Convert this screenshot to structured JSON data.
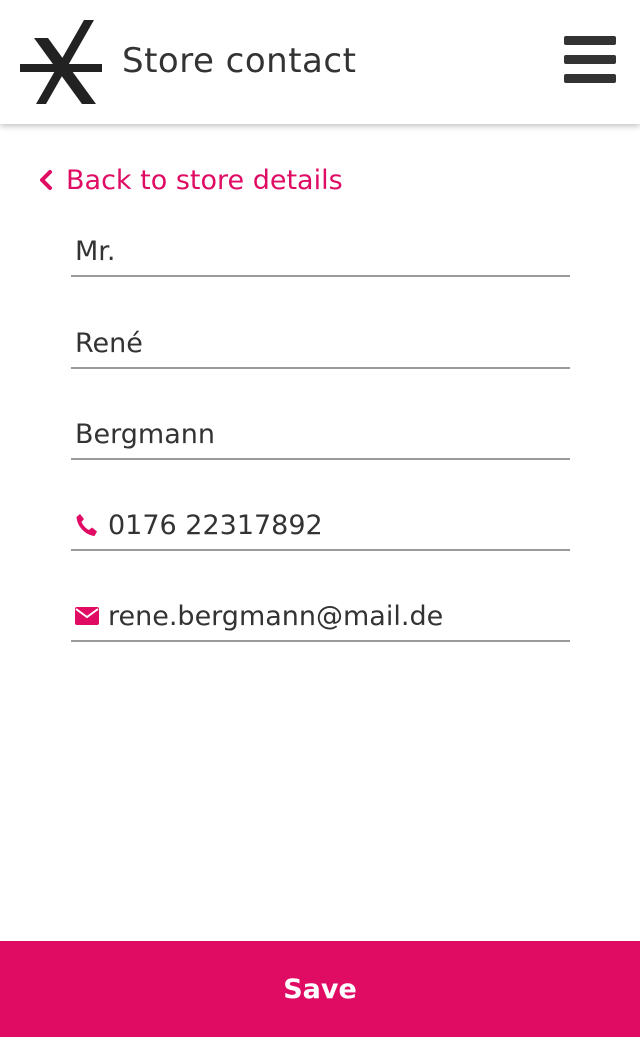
{
  "header": {
    "title": "Store contact",
    "logo_icon": "asterisk-x-logo",
    "menu_icon": "hamburger-menu-icon"
  },
  "back_link": {
    "icon": "chevron-left-icon",
    "label": "Back to store details"
  },
  "form": {
    "salutation": "Mr.",
    "first_name": "René",
    "last_name": "Bergmann",
    "phone": {
      "icon": "phone-icon",
      "value": "0176 22317892"
    },
    "email": {
      "icon": "envelope-icon",
      "value": "rene.bergmann@mail.de"
    }
  },
  "footer": {
    "save_label": "Save"
  },
  "colors": {
    "accent": "#e00b63",
    "text": "#333333",
    "underline": "#9a9a9a"
  }
}
